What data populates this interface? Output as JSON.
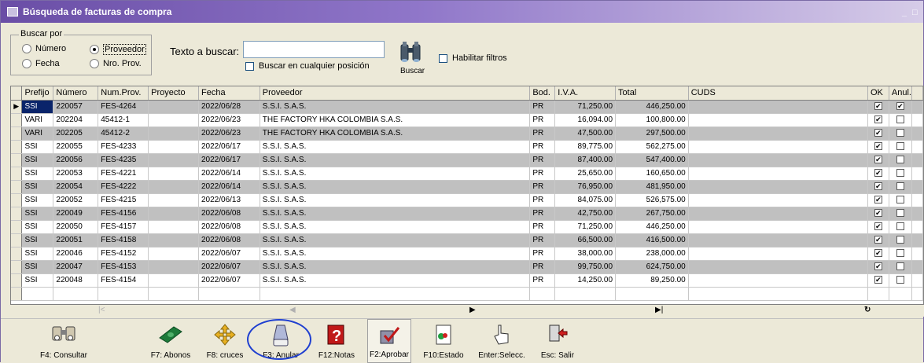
{
  "window": {
    "title": "Búsqueda de facturas de compra",
    "controls": "_ □"
  },
  "search": {
    "group_label": "Buscar por",
    "options": [
      {
        "label": "Número",
        "selected": false
      },
      {
        "label": "Proveedor",
        "selected": true
      },
      {
        "label": "Fecha",
        "selected": false
      },
      {
        "label": "Nro. Prov.",
        "selected": false
      }
    ],
    "text_label": "Texto a buscar:",
    "text_value": "",
    "any_position_label": "Buscar en cualquier posición",
    "any_position_checked": false,
    "search_button_label": "Buscar",
    "filters_label": "Habilitar filtros",
    "filters_checked": false
  },
  "grid": {
    "columns": [
      "Prefijo",
      "Número",
      "Num.Prov.",
      "Proyecto",
      "Fecha",
      "Proveedor",
      "Bod.",
      "I.V.A.",
      "Total",
      "CUDS",
      "OK",
      "Anul."
    ],
    "rows": [
      {
        "prefijo": "SSI",
        "numero": "220057",
        "numprov": "FES-4264",
        "proyecto": "",
        "fecha": "2022/06/28",
        "proveedor": "S.S.I.  S.A.S.",
        "bod": "PR",
        "iva": "71,250.00",
        "total": "446,250.00",
        "cuds": "",
        "ok": true,
        "anul": true
      },
      {
        "prefijo": "VARI",
        "numero": "202204",
        "numprov": "45412-1",
        "proyecto": "",
        "fecha": "2022/06/23",
        "proveedor": "THE FACTORY HKA COLOMBIA S.A.S.",
        "bod": "PR",
        "iva": "16,094.00",
        "total": "100,800.00",
        "cuds": "",
        "ok": true,
        "anul": false
      },
      {
        "prefijo": "VARI",
        "numero": "202205",
        "numprov": "45412-2",
        "proyecto": "",
        "fecha": "2022/06/23",
        "proveedor": "THE FACTORY HKA COLOMBIA S.A.S.",
        "bod": "PR",
        "iva": "47,500.00",
        "total": "297,500.00",
        "cuds": "",
        "ok": true,
        "anul": false
      },
      {
        "prefijo": "SSI",
        "numero": "220055",
        "numprov": "FES-4233",
        "proyecto": "",
        "fecha": "2022/06/17",
        "proveedor": "S.S.I.  S.A.S.",
        "bod": "PR",
        "iva": "89,775.00",
        "total": "562,275.00",
        "cuds": "",
        "ok": true,
        "anul": false
      },
      {
        "prefijo": "SSI",
        "numero": "220056",
        "numprov": "FES-4235",
        "proyecto": "",
        "fecha": "2022/06/17",
        "proveedor": "S.S.I.  S.A.S.",
        "bod": "PR",
        "iva": "87,400.00",
        "total": "547,400.00",
        "cuds": "",
        "ok": true,
        "anul": false
      },
      {
        "prefijo": "SSI",
        "numero": "220053",
        "numprov": "FES-4221",
        "proyecto": "",
        "fecha": "2022/06/14",
        "proveedor": "S.S.I.  S.A.S.",
        "bod": "PR",
        "iva": "25,650.00",
        "total": "160,650.00",
        "cuds": "",
        "ok": true,
        "anul": false
      },
      {
        "prefijo": "SSI",
        "numero": "220054",
        "numprov": "FES-4222",
        "proyecto": "",
        "fecha": "2022/06/14",
        "proveedor": "S.S.I.  S.A.S.",
        "bod": "PR",
        "iva": "76,950.00",
        "total": "481,950.00",
        "cuds": "",
        "ok": true,
        "anul": false
      },
      {
        "prefijo": "SSI",
        "numero": "220052",
        "numprov": "FES-4215",
        "proyecto": "",
        "fecha": "2022/06/13",
        "proveedor": "S.S.I.  S.A.S.",
        "bod": "PR",
        "iva": "84,075.00",
        "total": "526,575.00",
        "cuds": "",
        "ok": true,
        "anul": false
      },
      {
        "prefijo": "SSI",
        "numero": "220049",
        "numprov": "FES-4156",
        "proyecto": "",
        "fecha": "2022/06/08",
        "proveedor": "S.S.I.  S.A.S.",
        "bod": "PR",
        "iva": "42,750.00",
        "total": "267,750.00",
        "cuds": "",
        "ok": true,
        "anul": false
      },
      {
        "prefijo": "SSI",
        "numero": "220050",
        "numprov": "FES-4157",
        "proyecto": "",
        "fecha": "2022/06/08",
        "proveedor": "S.S.I.  S.A.S.",
        "bod": "PR",
        "iva": "71,250.00",
        "total": "446,250.00",
        "cuds": "",
        "ok": true,
        "anul": false
      },
      {
        "prefijo": "SSI",
        "numero": "220051",
        "numprov": "FES-4158",
        "proyecto": "",
        "fecha": "2022/06/08",
        "proveedor": "S.S.I.  S.A.S.",
        "bod": "PR",
        "iva": "66,500.00",
        "total": "416,500.00",
        "cuds": "",
        "ok": true,
        "anul": false
      },
      {
        "prefijo": "SSI",
        "numero": "220046",
        "numprov": "FES-4152",
        "proyecto": "",
        "fecha": "2022/06/07",
        "proveedor": "S.S.I.  S.A.S.",
        "bod": "PR",
        "iva": "38,000.00",
        "total": "238,000.00",
        "cuds": "",
        "ok": true,
        "anul": false
      },
      {
        "prefijo": "SSI",
        "numero": "220047",
        "numprov": "FES-4153",
        "proyecto": "",
        "fecha": "2022/06/07",
        "proveedor": "S.S.I.  S.A.S.",
        "bod": "PR",
        "iva": "99,750.00",
        "total": "624,750.00",
        "cuds": "",
        "ok": true,
        "anul": false
      },
      {
        "prefijo": "SSI",
        "numero": "220048",
        "numprov": "FES-4154",
        "proyecto": "",
        "fecha": "2022/06/07",
        "proveedor": "S.S.I.  S.A.S.",
        "bod": "PR",
        "iva": "14,250.00",
        "total": "89,250.00",
        "cuds": "",
        "ok": true,
        "anul": false
      }
    ]
  },
  "toolbar": [
    {
      "label": "F4: Consultar",
      "icon": "binoculars-icon"
    },
    {
      "label": "F7: Abonos",
      "icon": "money-icon"
    },
    {
      "label": "F8: cruces",
      "icon": "arrows-cross-icon"
    },
    {
      "label": "F3: Anular",
      "icon": "eraser-icon"
    },
    {
      "label": "F12:Notas",
      "icon": "help-notes-icon"
    },
    {
      "label": "F2:Aprobar",
      "icon": "approve-icon"
    },
    {
      "label": "F10:Estado",
      "icon": "status-icon"
    },
    {
      "label": "Enter:Selecc.",
      "icon": "hand-pointer-icon"
    },
    {
      "label": "Esc: Salir",
      "icon": "exit-door-icon"
    }
  ],
  "colors": {
    "titlebar": "#6a4ea6",
    "row_alt": "#c0c0c0",
    "highlight_circle": "#1f3fd0"
  }
}
